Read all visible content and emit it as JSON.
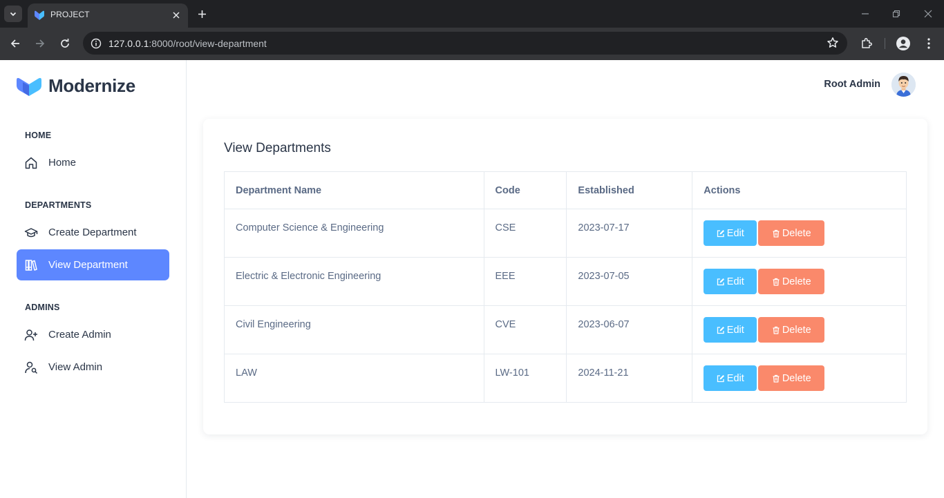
{
  "browser": {
    "tab_title": "PROJECT",
    "url_host": "127.0.0.1",
    "url_rest": ":8000/root/view-department"
  },
  "brand": {
    "name": "Modernize"
  },
  "sidebar": {
    "sections": [
      {
        "caption": "HOME",
        "items": [
          {
            "label": "Home",
            "icon": "home-icon"
          }
        ]
      },
      {
        "caption": "DEPARTMENTS",
        "items": [
          {
            "label": "Create Department",
            "icon": "graduation-cap-icon"
          },
          {
            "label": "View Department",
            "icon": "books-icon",
            "active": true
          }
        ]
      },
      {
        "caption": "ADMINS",
        "items": [
          {
            "label": "Create Admin",
            "icon": "user-plus-icon"
          },
          {
            "label": "View Admin",
            "icon": "user-search-icon"
          }
        ]
      }
    ]
  },
  "header": {
    "user_name": "Root Admin"
  },
  "page": {
    "title": "View Departments",
    "columns": [
      "Department Name",
      "Code",
      "Established",
      "Actions"
    ],
    "rows": [
      {
        "name": "Computer Science & Engineering",
        "code": "CSE",
        "established": "2023-07-17"
      },
      {
        "name": "Electric & Electronic Engineering",
        "code": "EEE",
        "established": "2023-07-05"
      },
      {
        "name": "Civil Engineering",
        "code": "CVE",
        "established": "2023-06-07"
      },
      {
        "name": "LAW",
        "code": "LW-101",
        "established": "2024-11-21"
      }
    ],
    "edit_label": "Edit",
    "delete_label": "Delete"
  },
  "colors": {
    "primary": "#5d87ff",
    "edit_button": "#49beff",
    "delete_button": "#fa896b",
    "text_dark": "#2a3547",
    "text_muted": "#5a6a85"
  }
}
